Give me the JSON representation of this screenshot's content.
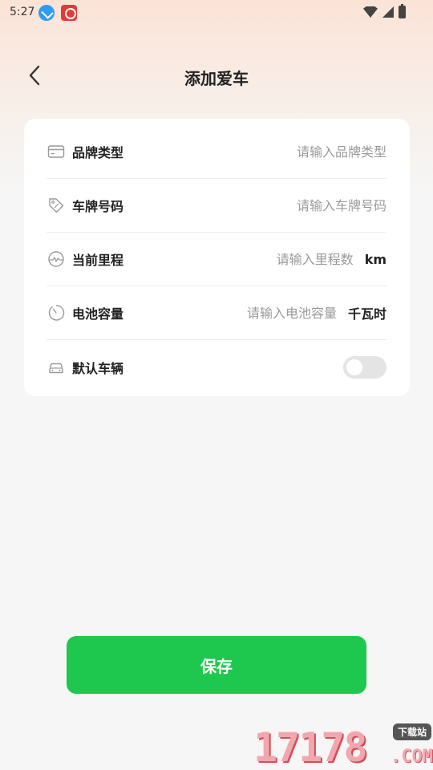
{
  "status_bar": {
    "time": "5:27",
    "icons": [
      "download-icon",
      "app-badge-icon",
      "wifi-icon",
      "signal-icon",
      "battery-icon"
    ]
  },
  "header": {
    "title": "添加爱车",
    "back_icon": "chevron-left-icon"
  },
  "form": {
    "rows": [
      {
        "icon": "card-icon",
        "label": "品牌类型",
        "placeholder": "请输入品牌类型",
        "value": ""
      },
      {
        "icon": "tag-icon",
        "label": "车牌号码",
        "placeholder": "请输入车牌号码",
        "value": ""
      },
      {
        "icon": "speedometer-icon",
        "label": "当前里程",
        "placeholder": "请输入里程数",
        "value": "",
        "unit": "km"
      },
      {
        "icon": "gauge-icon",
        "label": "电池容量",
        "placeholder": "请输入电池容量",
        "value": "",
        "unit": "千瓦时"
      },
      {
        "icon": "car-icon",
        "label": "默认车辆",
        "toggle": false
      }
    ]
  },
  "save_label": "保存",
  "watermark": {
    "digits": "17178",
    "tag": "下载站",
    "suffix": ".COM"
  },
  "colors": {
    "accent": "#1ec84f",
    "header_gradient": "#fbe3d6",
    "background": "#f6f6f6"
  }
}
